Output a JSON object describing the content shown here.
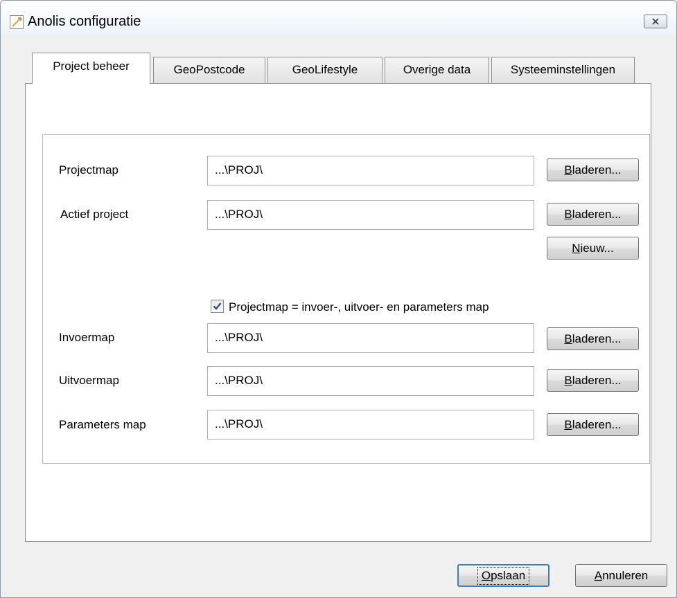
{
  "window": {
    "title": "Anolis configuratie"
  },
  "tabs": [
    {
      "label": "Project beheer",
      "active": true
    },
    {
      "label": "GeoPostcode",
      "active": false
    },
    {
      "label": "GeoLifestyle",
      "active": false
    },
    {
      "label": "Overige data",
      "active": false
    },
    {
      "label": "Systeeminstellingen",
      "active": false
    }
  ],
  "project": {
    "projectmap": {
      "label": "Projectmap",
      "value": "...\\PROJ\\",
      "browse": "Bladeren..."
    },
    "actief": {
      "label": "Actief project",
      "value": "...\\PROJ\\",
      "browse": "Bladeren...",
      "new": "Nieuw..."
    },
    "checkbox": {
      "label": "Projectmap = invoer-, uitvoer- en parameters map",
      "checked": true
    },
    "invoer": {
      "label": "Invoermap",
      "value": "...\\PROJ\\",
      "browse": "Bladeren..."
    },
    "uitvoer": {
      "label": "Uitvoermap",
      "value": "...\\PROJ\\",
      "browse": "Bladeren..."
    },
    "parameters": {
      "label": "Parameters map",
      "value": "...\\PROJ\\",
      "browse": "Bladeren..."
    }
  },
  "footer": {
    "save": "Opslaan",
    "cancel": "Annuleren"
  },
  "colors": {
    "default_button_border": "#3c7fb1",
    "titlebar_top": "#ffffff",
    "checkmark": "#2a4e8a"
  }
}
